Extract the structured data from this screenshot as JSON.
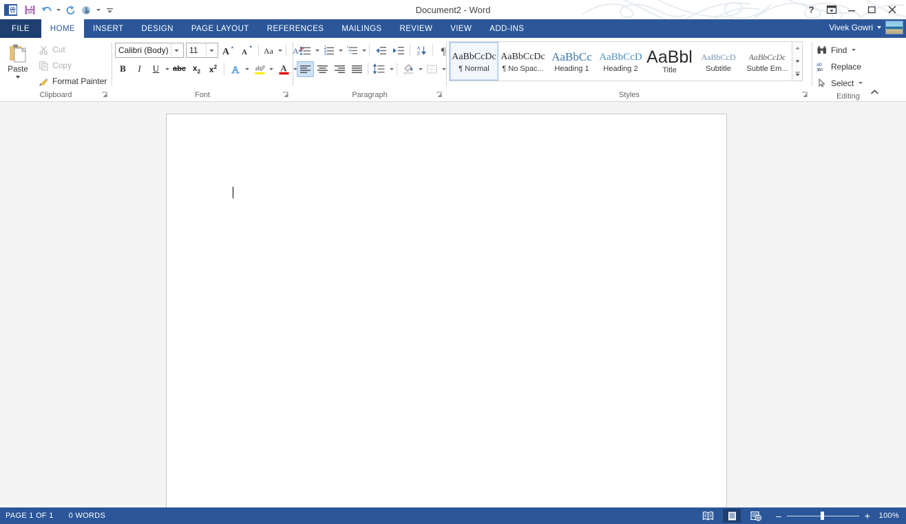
{
  "titlebar": {
    "document_title": "Document2 - Word",
    "quick_access": [
      {
        "name": "save-button",
        "icon": "save-icon"
      },
      {
        "name": "undo-button",
        "icon": "undo-icon"
      },
      {
        "name": "redo-button",
        "icon": "redo-icon"
      },
      {
        "name": "touch-mode-button",
        "icon": "touch-mode-icon"
      },
      {
        "name": "customize-qat-button",
        "icon": "chevron-down-icon"
      }
    ],
    "window_buttons": {
      "help": "?",
      "ribbon_display_options": "ribbon-options-icon",
      "minimize": "minimize-icon",
      "restore": "restore-icon",
      "close": "close-icon"
    }
  },
  "tabs": [
    {
      "label": "FILE",
      "active": false,
      "file": true
    },
    {
      "label": "HOME",
      "active": true,
      "file": false
    },
    {
      "label": "INSERT",
      "active": false,
      "file": false
    },
    {
      "label": "DESIGN",
      "active": false,
      "file": false
    },
    {
      "label": "PAGE LAYOUT",
      "active": false,
      "file": false
    },
    {
      "label": "REFERENCES",
      "active": false,
      "file": false
    },
    {
      "label": "MAILINGS",
      "active": false,
      "file": false
    },
    {
      "label": "REVIEW",
      "active": false,
      "file": false
    },
    {
      "label": "VIEW",
      "active": false,
      "file": false
    },
    {
      "label": "ADD-INS",
      "active": false,
      "file": false
    }
  ],
  "account": {
    "user_name": "Vivek Gowri"
  },
  "ribbon": {
    "groups": {
      "clipboard": {
        "label": "Clipboard",
        "paste_label": "Paste",
        "items": [
          {
            "label": "Cut",
            "disabled": true
          },
          {
            "label": "Copy",
            "disabled": true
          },
          {
            "label": "Format Painter",
            "disabled": false
          }
        ]
      },
      "font": {
        "label": "Font",
        "font_name": "Calibri (Body)",
        "font_size": "11",
        "buttons": [
          "grow-font",
          "shrink-font",
          "change-case",
          "clear-formatting",
          "bold",
          "italic",
          "underline",
          "strikethrough",
          "subscript",
          "superscript",
          "text-effects",
          "text-highlight-color",
          "font-color"
        ]
      },
      "paragraph": {
        "label": "Paragraph",
        "buttons": [
          "bullets",
          "numbering",
          "multilevel-list",
          "decrease-indent",
          "increase-indent",
          "sort",
          "show-formatting-marks",
          "align-left",
          "center",
          "align-right",
          "justify",
          "line-spacing",
          "shading",
          "borders"
        ],
        "selected": "align-left"
      },
      "styles": {
        "label": "Styles",
        "items": [
          {
            "preview": "AaBbCcDc",
            "name": "¶ Normal",
            "selected": true,
            "color": "#2b2b2b",
            "size": "14px",
            "italic": false
          },
          {
            "preview": "AaBbCcDc",
            "name": "¶ No Spac...",
            "selected": false,
            "color": "#2b2b2b",
            "size": "14px",
            "italic": false
          },
          {
            "preview": "AaBbCc",
            "name": "Heading 1",
            "selected": false,
            "color": "#3e7aa8",
            "size": "17px",
            "italic": false
          },
          {
            "preview": "AaBbCcD",
            "name": "Heading 2",
            "selected": false,
            "color": "#4a8fc0",
            "size": "15px",
            "italic": false
          },
          {
            "preview": "AaBbl",
            "name": "Title",
            "selected": false,
            "color": "#2b2b2b",
            "size": "24px",
            "italic": false
          },
          {
            "preview": "AaBbCcD",
            "name": "Subtitle",
            "selected": false,
            "color": "#6e8fb0",
            "size": "12px",
            "italic": false
          },
          {
            "preview": "AaBbCcDc",
            "name": "Subtle Em...",
            "selected": false,
            "color": "#5a5a5a",
            "size": "12px",
            "italic": true
          }
        ]
      },
      "editing": {
        "label": "Editing",
        "items": [
          {
            "label": "Find",
            "icon": "binoculars-icon",
            "caret": true
          },
          {
            "label": "Replace",
            "icon": "replace-icon",
            "caret": false
          },
          {
            "label": "Select",
            "icon": "select-pointer-icon",
            "caret": true
          }
        ]
      }
    }
  },
  "statusbar": {
    "page_info": "PAGE 1 OF 1",
    "word_count": "0 WORDS",
    "views": [
      {
        "name": "read-mode",
        "active": false
      },
      {
        "name": "print-layout",
        "active": true
      },
      {
        "name": "web-layout",
        "active": false
      }
    ],
    "zoom_out": "–",
    "zoom_in": "+",
    "zoom_level": "100%"
  },
  "colors": {
    "accent": "#2b579a",
    "file_tab": "#1e3f6f",
    "workspace": "#f4f4f4",
    "page": "#ffffff"
  }
}
